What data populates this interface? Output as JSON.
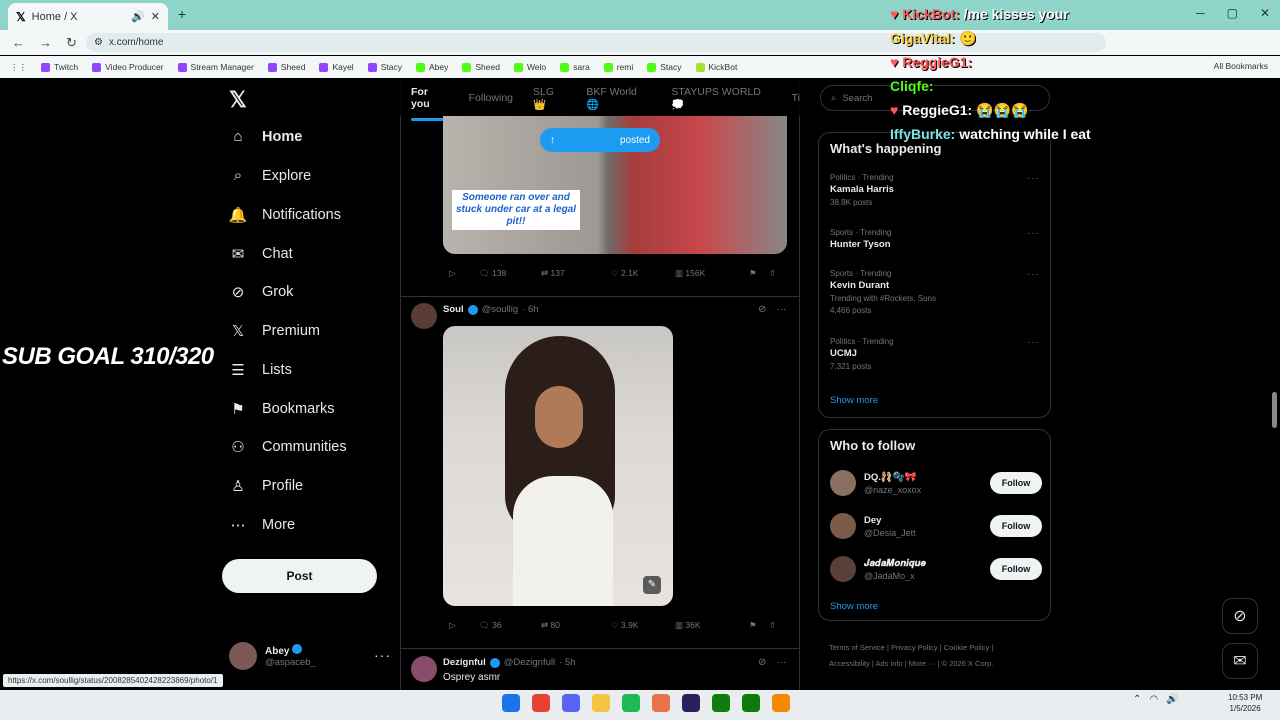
{
  "browser": {
    "tab_title": "Home / X",
    "url": "x.com/home",
    "bookmarks": [
      {
        "label": "Twitch",
        "color": "#9146ff"
      },
      {
        "label": "Video Producer",
        "color": "#9146ff"
      },
      {
        "label": "Stream Manager",
        "color": "#9146ff"
      },
      {
        "label": "Sheed",
        "color": "#9146ff"
      },
      {
        "label": "Kayel",
        "color": "#9146ff"
      },
      {
        "label": "Stacy",
        "color": "#9146ff"
      },
      {
        "label": "Abey",
        "color": "#53fc18"
      },
      {
        "label": "Sheed",
        "color": "#53fc18"
      },
      {
        "label": "Welo",
        "color": "#53fc18"
      },
      {
        "label": "sara",
        "color": "#53fc18"
      },
      {
        "label": "remi",
        "color": "#53fc18"
      },
      {
        "label": "Stacy",
        "color": "#53fc18"
      },
      {
        "label": "KickBot",
        "color": "#a6e22e"
      }
    ],
    "all_bookmarks": "All Bookmarks",
    "status_url": "https://x.com/soullig/status/2008285402428223869/photo/1"
  },
  "nav": {
    "items": [
      {
        "label": "Home",
        "icon": "home-icon",
        "glyph": "⌂"
      },
      {
        "label": "Explore",
        "icon": "search-icon",
        "glyph": "⌕"
      },
      {
        "label": "Notifications",
        "icon": "bell-icon",
        "glyph": "🔔"
      },
      {
        "label": "Chat",
        "icon": "mail-icon",
        "glyph": "✉"
      },
      {
        "label": "Grok",
        "icon": "grok-icon",
        "glyph": "⊘"
      },
      {
        "label": "Premium",
        "icon": "x-premium-icon",
        "glyph": "𝕏"
      },
      {
        "label": "Lists",
        "icon": "list-icon",
        "glyph": "☰"
      },
      {
        "label": "Bookmarks",
        "icon": "bookmark-icon",
        "glyph": "⚑"
      },
      {
        "label": "Communities",
        "icon": "communities-icon",
        "glyph": "⚇"
      },
      {
        "label": "Profile",
        "icon": "profile-icon",
        "glyph": "♙"
      },
      {
        "label": "More",
        "icon": "more-circle-icon",
        "glyph": "⋯"
      }
    ],
    "post_button": "Post",
    "account": {
      "name": "Abey",
      "handle": "@aspaceb_"
    }
  },
  "overlay": {
    "sub_goal": "SUB GOAL 310/320",
    "chat": [
      {
        "user": "KickBot:",
        "message": "/me kisses your",
        "color": "#ff5a5a",
        "badge": "♥"
      },
      {
        "user": "GigaVital:",
        "message": "🙂",
        "color": "#f5d142",
        "badge": ""
      },
      {
        "user": "ReggieG1:",
        "message": "",
        "color": "#ff5a5a",
        "badge": "♥"
      },
      {
        "user": "Cliqfe:",
        "message": "",
        "color": "#53fc18",
        "badge": ""
      },
      {
        "user": "ReggieG1:",
        "message": "😭😭😭",
        "color": "#ffffff",
        "badge": "♥"
      },
      {
        "user": "IffyBurke:",
        "message": "watching while I eat",
        "color": "#7fe3e3",
        "badge": ""
      }
    ]
  },
  "feed": {
    "tabs": [
      "For you",
      "Following",
      "SLG👑",
      "BKF World 🌐",
      "STAYUPS WORLD💭",
      "Ti"
    ],
    "posted_label": "posted",
    "tweet1": {
      "caption": "Someone ran over and stuck under car at a legal pit!!",
      "replies": "138",
      "reposts": "137",
      "likes": "2.1K",
      "views": "156K"
    },
    "tweet2": {
      "name": "Soul",
      "handle": "@soullig",
      "time": "· 6h",
      "replies": "36",
      "reposts": "80",
      "likes": "3.9K",
      "views": "36K"
    },
    "tweet3": {
      "name": "Dezignful",
      "handle": "@Dezignfull",
      "time": "· 5h",
      "text": "Osprey asmr"
    }
  },
  "sidebar": {
    "search_placeholder": "Search",
    "happening_title": "What's happening",
    "trends": [
      {
        "category": "Politics · Trending",
        "name": "Kamala Harris",
        "count": "38.8K posts"
      },
      {
        "category": "Sports · Trending",
        "name": "Hunter Tyson",
        "count": ""
      },
      {
        "category": "Sports · Trending",
        "name": "Kevin Durant",
        "extra": "Trending with #Rockets, Suns",
        "count": "4,466 posts"
      },
      {
        "category": "Politics · Trending",
        "name": "UCMJ",
        "count": "7,321 posts"
      }
    ],
    "show_more": "Show more",
    "who_to_follow_title": "Who to follow",
    "follow_suggestions": [
      {
        "name": "DQ.🩰🫧🎀",
        "handle": "@naze_xoxox",
        "color": "#8a7060"
      },
      {
        "name": "Dey",
        "handle": "@Desia_Jett",
        "color": "#7b5a4a"
      },
      {
        "name": "𝑱𝒂𝒅𝒂𝑴𝒐𝒏𝒊𝒒𝒖𝒆",
        "handle": "@JadaMo_x",
        "color": "#5a4038"
      }
    ],
    "follow_label": "Follow",
    "footer": [
      "Terms of Service",
      "Privacy Policy",
      "Cookie Policy",
      "Accessibility",
      "Ads info",
      "More ···",
      "© 2026 X Corp."
    ]
  },
  "taskbar": {
    "time": "10:53 PM",
    "date": "1/5/2026",
    "apps": [
      {
        "name": "start-icon",
        "color": "#1a73e8"
      },
      {
        "name": "chrome-icon",
        "color": "#e94235"
      },
      {
        "name": "discord-icon",
        "color": "#5865f2"
      },
      {
        "name": "files-icon",
        "color": "#f6c343"
      },
      {
        "name": "spotify-icon",
        "color": "#1db954"
      },
      {
        "name": "app-icon",
        "color": "#e8734a"
      },
      {
        "name": "premiere-icon",
        "color": "#2a1f5c"
      },
      {
        "name": "xbox-app-icon",
        "color": "#107c10"
      },
      {
        "name": "xbox-icon",
        "color": "#0e7a0d"
      },
      {
        "name": "vlc-icon",
        "color": "#f28b00"
      }
    ]
  }
}
